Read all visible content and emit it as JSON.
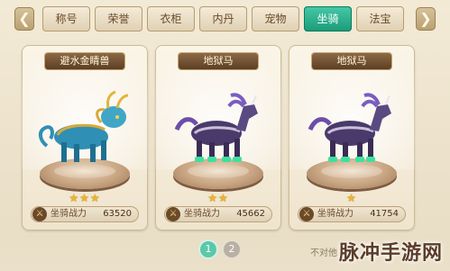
{
  "tabs": [
    {
      "label": "称号",
      "active": false
    },
    {
      "label": "荣誉",
      "active": false
    },
    {
      "label": "衣柜",
      "active": false
    },
    {
      "label": "内丹",
      "active": false
    },
    {
      "label": "宠物",
      "active": false
    },
    {
      "label": "坐骑",
      "active": true
    },
    {
      "label": "法宝",
      "active": false
    }
  ],
  "nav": {
    "left_icon": "chevron-left-icon",
    "right_icon": "chevron-right-icon",
    "left_glyph": "❮",
    "right_glyph": "❯"
  },
  "cards": [
    {
      "name": "避水金睛兽",
      "stars": "★★★",
      "star_count": 3,
      "power_label": "坐骑战力",
      "power_value": "63520",
      "mount_color": "#2f8fb5"
    },
    {
      "name": "地狱马",
      "stars": "★★",
      "star_count": 2,
      "power_label": "坐骑战力",
      "power_value": "45662",
      "mount_color": "#4a3a6b"
    },
    {
      "name": "地狱马",
      "stars": "★",
      "star_count": 1,
      "power_label": "坐骑战力",
      "power_value": "41754",
      "mount_color": "#4a3a6b"
    }
  ],
  "pager": {
    "page1": "1",
    "page2": "2",
    "current": 1
  },
  "hint_text": "不对他",
  "watermark": "脉冲手游网",
  "colors": {
    "active_tab": "#199b78",
    "star": "#f0b429",
    "banner": "#5c3e24"
  }
}
